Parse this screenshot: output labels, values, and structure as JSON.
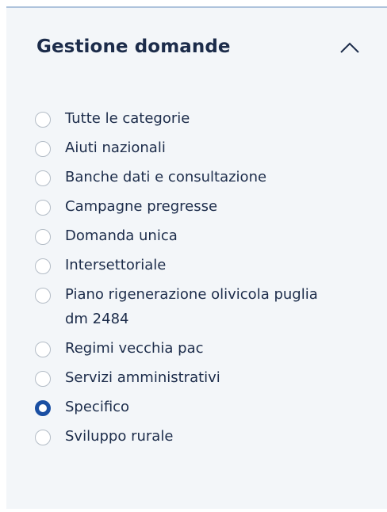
{
  "section": {
    "title": "Gestione domande",
    "toggle_icon": "chevron-up-icon"
  },
  "options": [
    {
      "label": "Tutte le categorie",
      "checked": false
    },
    {
      "label": "Aiuti nazionali",
      "checked": false
    },
    {
      "label": "Banche dati e consultazione",
      "checked": false
    },
    {
      "label": "Campagne pregresse",
      "checked": false
    },
    {
      "label": "Domanda unica",
      "checked": false
    },
    {
      "label": "Intersettoriale",
      "checked": false
    },
    {
      "label": "Piano rigenerazione olivicola puglia dm 2484",
      "checked": false
    },
    {
      "label": "Regimi vecchia pac",
      "checked": false
    },
    {
      "label": "Servizi amministrativi",
      "checked": false
    },
    {
      "label": "Specifico",
      "checked": true
    },
    {
      "label": "Sviluppo rurale",
      "checked": false
    }
  ],
  "colors": {
    "accent": "#1a4fa3",
    "text": "#1c2c4a",
    "panel_bg": "#f3f6f9"
  }
}
